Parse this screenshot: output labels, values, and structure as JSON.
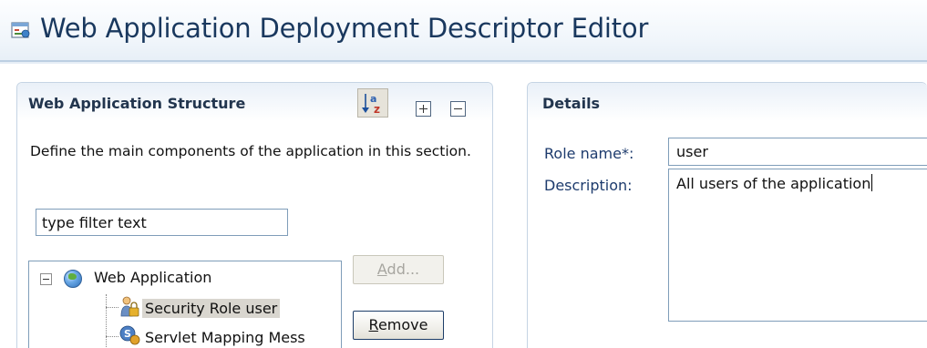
{
  "header": {
    "title": "Web Application Deployment Descriptor Editor",
    "icon": "web-deployment-descriptor-icon"
  },
  "structure": {
    "title": "Web Application Structure",
    "toolbar": {
      "sort_icon": "sort-alphabetically-icon",
      "expand_icon": "expand-all-icon",
      "collapse_icon": "collapse-all-icon"
    },
    "description": "Define the main components of the application in this section.",
    "filter": {
      "value": "type filter text"
    },
    "tree": {
      "root": {
        "label": "Web Application",
        "icon": "globe-icon",
        "expanded": true
      },
      "children": [
        {
          "label": "Security Role user",
          "icon": "security-role-icon",
          "selected": true
        },
        {
          "label": "Servlet Mapping Mess",
          "icon": "servlet-mapping-icon",
          "selected": false
        }
      ]
    },
    "buttons": {
      "add_prefix": "",
      "add_mnemonic": "A",
      "add_suffix": "dd...",
      "add_enabled": false,
      "remove_mnemonic": "R",
      "remove_suffix": "emove"
    }
  },
  "details": {
    "title": "Details",
    "role_name_label": "Role name*:",
    "role_name_value": "user",
    "description_label": "Description:",
    "description_value": "All users of the application"
  },
  "colors": {
    "title_text": "#19385e",
    "label_text": "#1d3b6d",
    "selection_bg": "#d9d6cf",
    "border": "#7f9db9"
  }
}
